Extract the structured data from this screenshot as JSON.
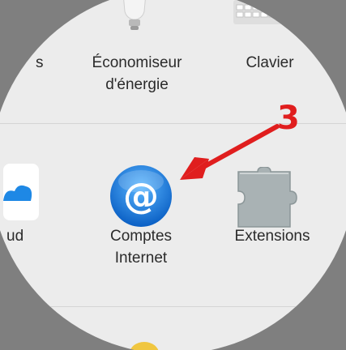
{
  "colors": {
    "annotation_red": "#e01e1e",
    "panel_background": "#ececec",
    "at_icon_blue": "#1e88e5"
  },
  "preferences": {
    "top_row": {
      "partial_left_label": "s",
      "energy_saver": {
        "line1": "Économiseur",
        "line2": "d'énergie",
        "icon": "lightbulb-icon"
      },
      "keyboard": {
        "label": "Clavier",
        "icon": "keyboard-icon"
      }
    },
    "middle_row": {
      "icloud_partial": {
        "label": "ud",
        "icon": "cloud-icon"
      },
      "internet_accounts": {
        "line1": "Comptes",
        "line2": "Internet",
        "icon": "at-sign-icon"
      },
      "extensions": {
        "label": "Extensions",
        "icon": "puzzle-piece-icon"
      }
    },
    "bottom_row": {
      "partial_icon": "yellow-icon"
    }
  },
  "annotation": {
    "step_number": "3",
    "arrow": "red-arrow-icon"
  }
}
